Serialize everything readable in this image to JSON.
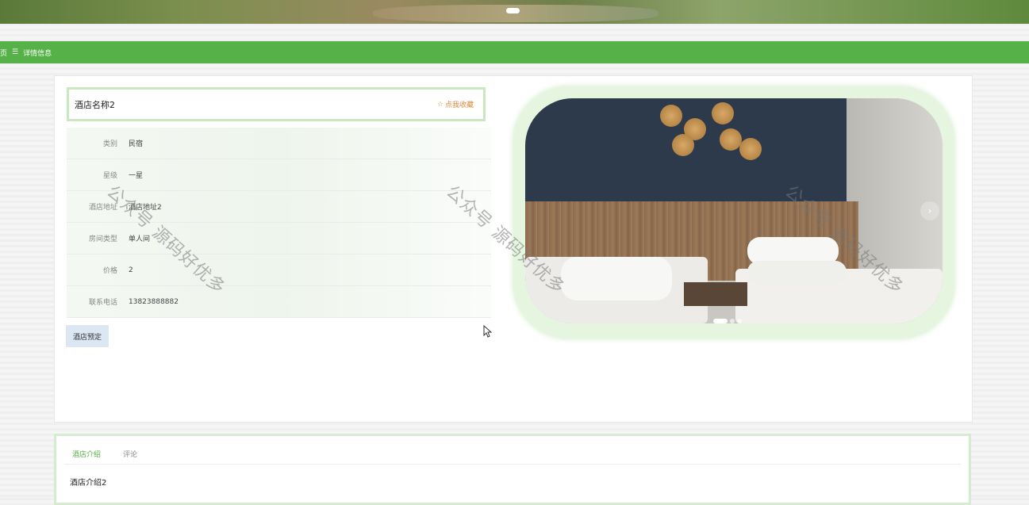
{
  "breadcrumb": {
    "home": "页",
    "separator": "☰",
    "current": "详情信息"
  },
  "hotel": {
    "name": "酒店名称2",
    "favorite_label": "点我收藏",
    "fields": [
      {
        "label": "类别",
        "value": "民宿"
      },
      {
        "label": "星级",
        "value": "一星"
      },
      {
        "label": "酒店地址",
        "value": "酒店地址2"
      },
      {
        "label": "房间类型",
        "value": "单人间"
      },
      {
        "label": "价格",
        "value": "2"
      },
      {
        "label": "联系电话",
        "value": "13823888882"
      }
    ],
    "book_button": "酒店预定"
  },
  "carousel": {
    "next_icon": "›",
    "prev_icon": "‹",
    "slide_count": 3,
    "active_index": 0
  },
  "tabs": [
    {
      "label": "酒店介绍",
      "active": true
    },
    {
      "label": "评论",
      "active": false
    }
  ],
  "intro_text": "酒店介绍2",
  "watermark": "公众号 源码好优多",
  "colors": {
    "accent": "#57b149",
    "favorite": "#e08a3c",
    "button": "#dbe7f3"
  }
}
